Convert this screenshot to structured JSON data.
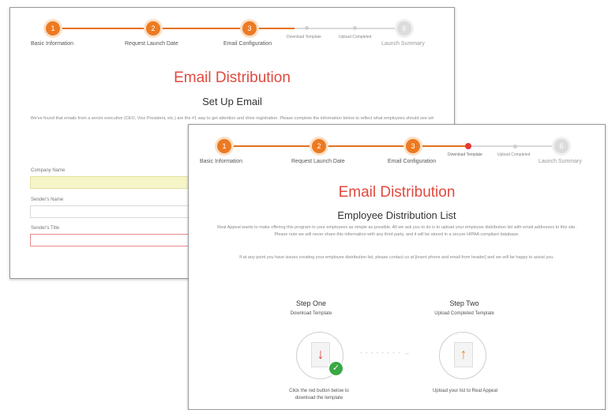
{
  "back": {
    "steps": [
      {
        "num": "1",
        "label": "Basic Information"
      },
      {
        "num": "2",
        "label": "Request Launch Date"
      },
      {
        "num": "3",
        "label": "Email Configuration"
      },
      {
        "num": "",
        "label": "Download Template"
      },
      {
        "num": "",
        "label": "Upload Completed"
      },
      {
        "num": "6",
        "label": "Launch Summary"
      }
    ],
    "title": "Email Distribution",
    "subtitle": "Set Up Email",
    "intro": "We've found that emails from a senior executive (CEO, Vice President, etc.) are the #1 way to get attention and drive registration. Please complete the information below to reflect what employees should see wh",
    "fields": [
      {
        "label": "Company Name"
      },
      {
        "label": "Sender's Name"
      },
      {
        "label": "Sender's Title"
      }
    ]
  },
  "front": {
    "steps": [
      {
        "num": "1",
        "label": "Basic Information"
      },
      {
        "num": "2",
        "label": "Request Launch Date"
      },
      {
        "num": "3",
        "label": "Email Configuration"
      },
      {
        "num": "",
        "label": "Download Template"
      },
      {
        "num": "",
        "label": "Upload Completed"
      },
      {
        "num": "6",
        "label": "Launch Summary"
      }
    ],
    "title": "Email Distribution",
    "subtitle": "Employee Distribution List",
    "para1": "Real Appeal wants to make offering this program to your employees as simple as possible. All we ask you to do is to upload your employee distribution list with email addresses to this site. Please note we will never share this information with any third party, and it will be stored in a secure HIPAA compliant database.",
    "para2": "If at any point you have issues creating your employee distribution list, please contact us at [insert phone and email from header] and we will be happy to assist you.",
    "step_one": {
      "title": "Step One",
      "sub": "Download Template",
      "caption": "Click the red button below to download the template"
    },
    "step_two": {
      "title": "Step Two",
      "sub": "Upload Completed Template",
      "caption": "Upload your list to Real Appeal"
    },
    "dash_line": "- - - - - - - - →"
  },
  "colors": {
    "accent": "#ec7a22",
    "title_red": "#e04a3f",
    "check_green": "#3aa844",
    "arrow_red": "#e53935",
    "arrow_orange": "#f08a1c"
  },
  "icons": {
    "download": "down-arrow-doc-icon",
    "upload": "up-arrow-doc-icon",
    "check": "checkmark-icon"
  }
}
